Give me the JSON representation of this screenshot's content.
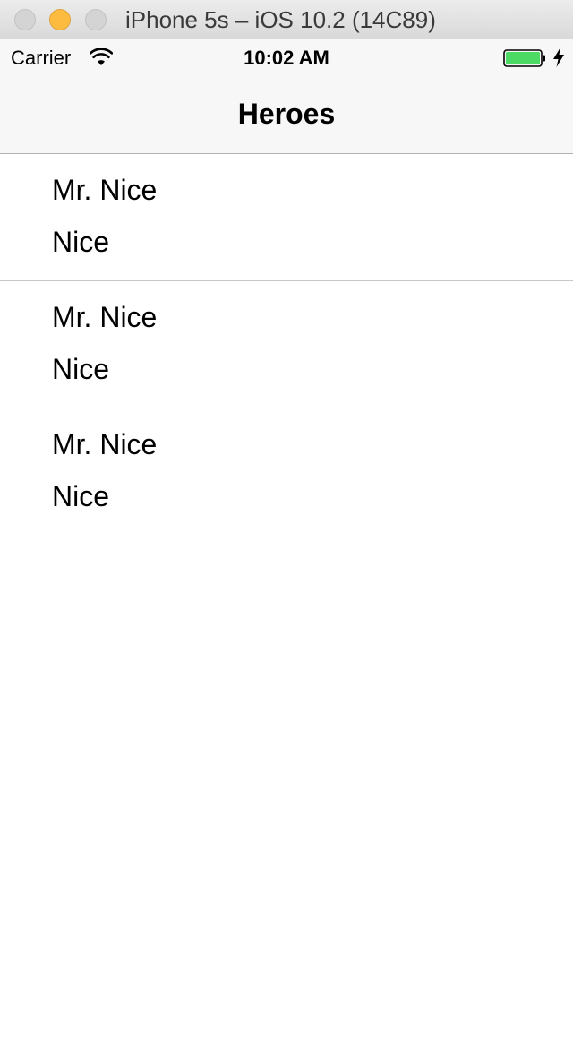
{
  "window": {
    "title": "iPhone 5s – iOS 10.2 (14C89)"
  },
  "status_bar": {
    "carrier": "Carrier",
    "time": "10:02 AM",
    "battery_color": "#4cd964",
    "icons": [
      "wifi-icon",
      "battery-icon",
      "charging-bolt-icon"
    ]
  },
  "nav_bar": {
    "title": "Heroes"
  },
  "heroes": [
    {
      "name": "Mr. Nice",
      "subtitle": "Nice"
    },
    {
      "name": "Mr. Nice",
      "subtitle": "Nice"
    },
    {
      "name": "Mr. Nice",
      "subtitle": "Nice"
    }
  ]
}
